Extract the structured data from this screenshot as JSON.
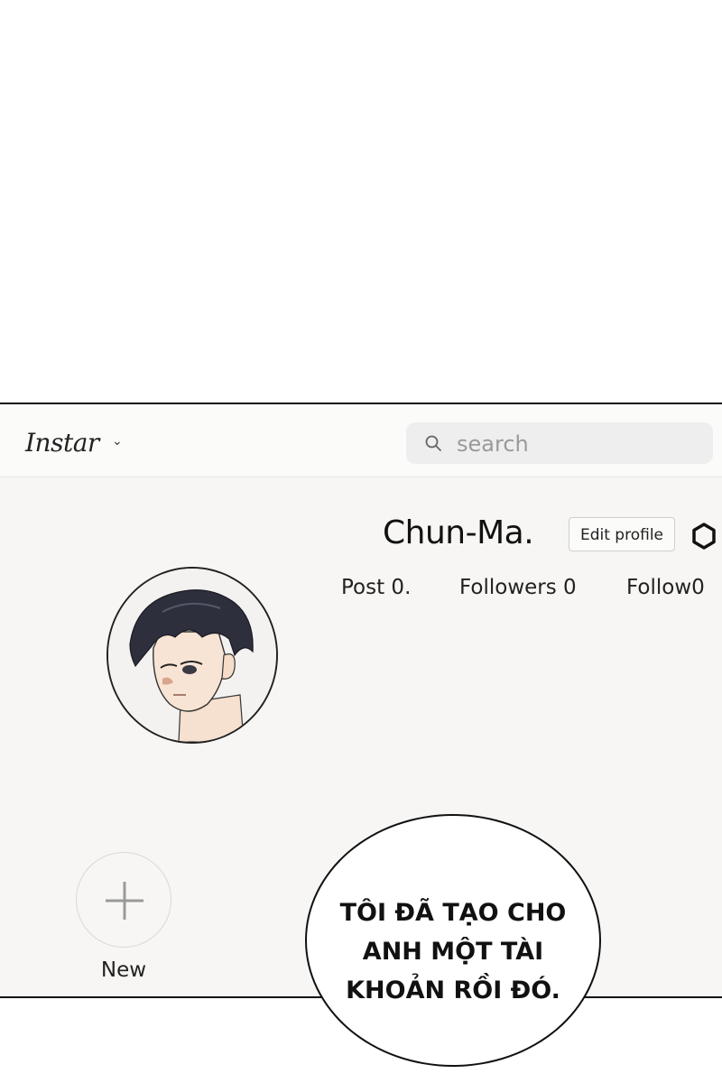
{
  "header": {
    "brand": "Instar",
    "brand_caret": "⌄",
    "search_placeholder": "search"
  },
  "profile": {
    "username": "Chun-Ma.",
    "edit_label": "Edit profile",
    "stats": {
      "posts": "Post 0.",
      "followers": "Followers 0",
      "following": "Follow0"
    }
  },
  "highlights": {
    "new_label": "New"
  },
  "speech_bubble": {
    "lines": [
      "TÔI ĐÃ TẠO CHO",
      "ANH MỘT TÀI",
      "KHOẢN RỒI ĐÓ."
    ]
  },
  "colors": {
    "panel_bg": "#f7f6f4",
    "border": "#111111",
    "search_bg": "#eeeeee",
    "muted_text": "#9a9a9a"
  }
}
